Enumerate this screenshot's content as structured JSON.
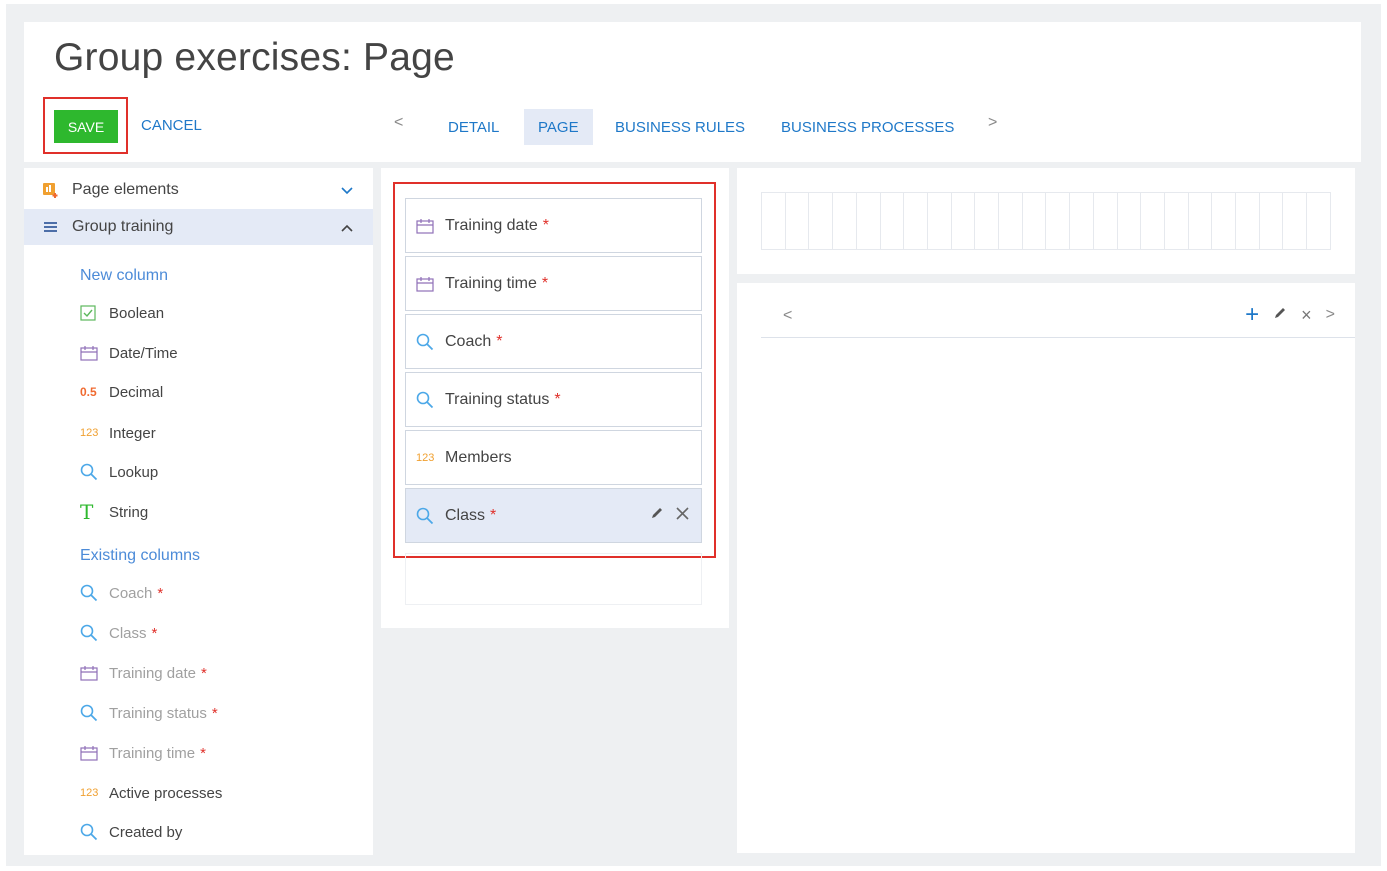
{
  "header": {
    "title": "Group exercises: Page",
    "save_label": "SAVE",
    "cancel_label": "CANCEL",
    "tabs": [
      {
        "label": "DETAIL",
        "active": false
      },
      {
        "label": "PAGE",
        "active": true
      },
      {
        "label": "BUSINESS RULES",
        "active": false
      },
      {
        "label": "BUSINESS PROCESSES",
        "active": false
      }
    ],
    "prev_arrow": "<",
    "next_arrow": ">"
  },
  "left_panel": {
    "page_elements_label": "Page elements",
    "group_label": "Group training",
    "new_column_label": "New column",
    "new_columns": [
      {
        "label": "Boolean",
        "icon": "checkbox-icon"
      },
      {
        "label": "Date/Time",
        "icon": "calendar-icon"
      },
      {
        "label": "Decimal",
        "icon": "decimal-icon",
        "glyph": "0.5"
      },
      {
        "label": "Integer",
        "icon": "integer-icon",
        "glyph": "123"
      },
      {
        "label": "Lookup",
        "icon": "search-icon"
      },
      {
        "label": "String",
        "icon": "text-icon",
        "glyph": "T"
      }
    ],
    "existing_columns_label": "Existing columns",
    "existing_columns": [
      {
        "label": "Coach",
        "icon": "search-icon",
        "required": true,
        "muted": true
      },
      {
        "label": "Class",
        "icon": "search-icon",
        "required": true,
        "muted": true
      },
      {
        "label": "Training date",
        "icon": "calendar-icon",
        "required": true,
        "muted": true
      },
      {
        "label": "Training status",
        "icon": "search-icon",
        "required": true,
        "muted": true
      },
      {
        "label": "Training time",
        "icon": "calendar-icon",
        "required": true,
        "muted": true
      },
      {
        "label": "Active processes",
        "icon": "integer-icon",
        "glyph": "123",
        "required": false,
        "muted": false
      },
      {
        "label": "Created by",
        "icon": "search-icon",
        "required": false,
        "muted": false
      }
    ]
  },
  "fields": [
    {
      "label": "Training date",
      "icon": "calendar-icon",
      "required": true
    },
    {
      "label": "Training time",
      "icon": "calendar-icon",
      "required": true
    },
    {
      "label": "Coach",
      "icon": "search-icon",
      "required": true
    },
    {
      "label": "Training status",
      "icon": "search-icon",
      "required": true
    },
    {
      "label": "Members",
      "icon": "integer-icon",
      "glyph": "123",
      "required": false
    },
    {
      "label": "Class",
      "icon": "search-icon",
      "required": true,
      "selected": true
    }
  ],
  "required_mark": "*",
  "detail_toolbar": {
    "prev": "<",
    "next": ">",
    "add": "+",
    "remove": "×"
  },
  "colors": {
    "accent": "#1e78c8",
    "save": "#2eb82e",
    "highlight_outline": "#e0302a",
    "selected_bg": "#e4eaf6"
  }
}
